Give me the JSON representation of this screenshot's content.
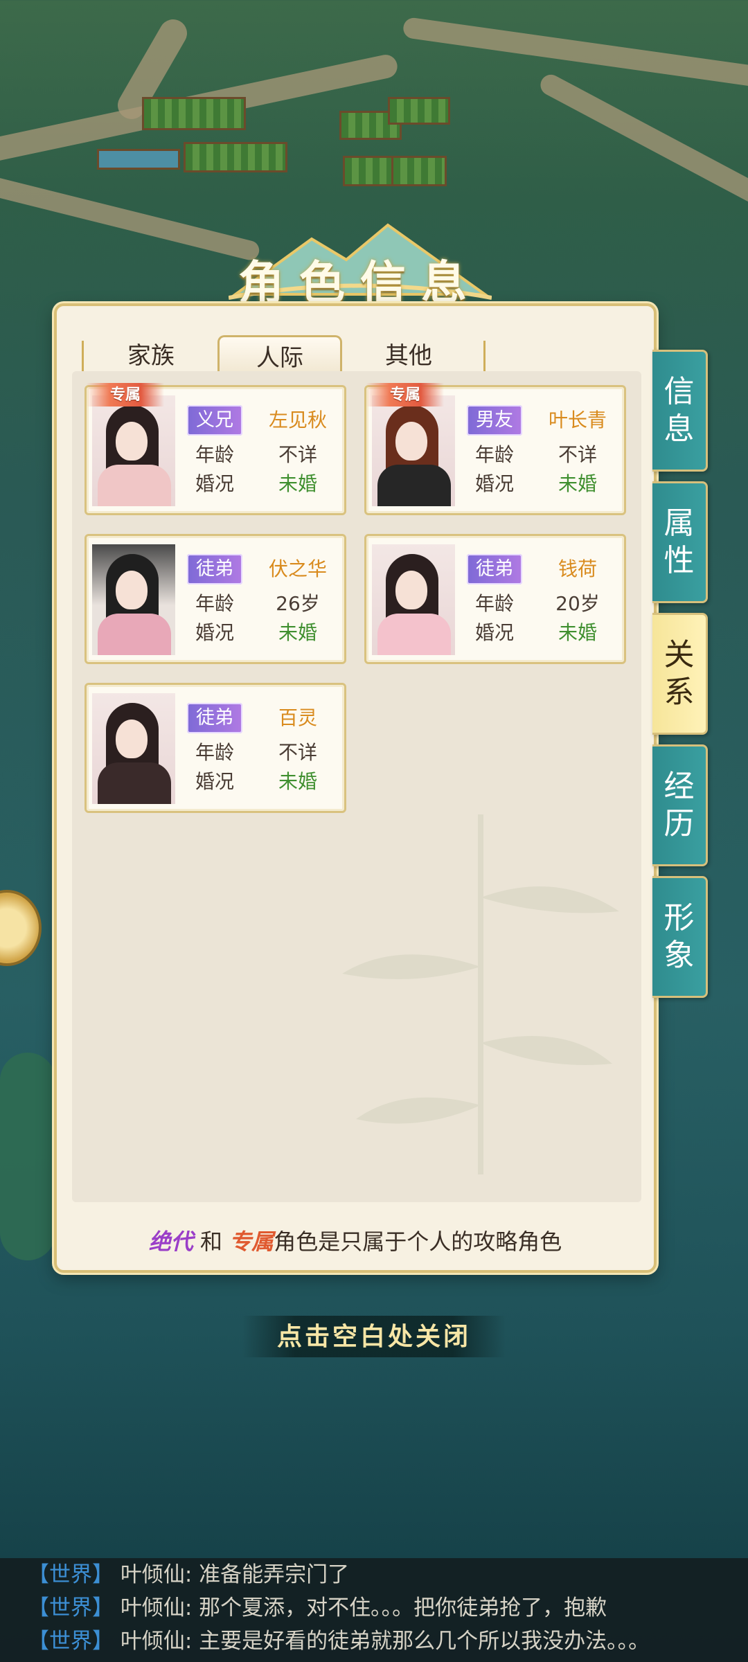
{
  "title": "角色信息",
  "tabs": [
    {
      "label": "家族",
      "active": false
    },
    {
      "label": "人际",
      "active": true
    },
    {
      "label": "其他",
      "active": false
    }
  ],
  "side_tabs": [
    {
      "label": "信息",
      "chars": [
        "信",
        "息"
      ],
      "active": false
    },
    {
      "label": "属性",
      "chars": [
        "属",
        "性"
      ],
      "active": false
    },
    {
      "label": "关系",
      "chars": [
        "关",
        "系"
      ],
      "active": true
    },
    {
      "label": "经历",
      "chars": [
        "经",
        "历"
      ],
      "active": false
    },
    {
      "label": "形象",
      "chars": [
        "形",
        "象"
      ],
      "active": false
    }
  ],
  "labels": {
    "age": "年龄",
    "marriage": "婚况"
  },
  "cards": [
    {
      "badge": "专属",
      "relation": "义兄",
      "name": "左见秋",
      "age": "不详",
      "marriage": "未婚"
    },
    {
      "badge": "专属",
      "relation": "男友",
      "name": "叶长青",
      "age": "不详",
      "marriage": "未婚"
    },
    {
      "badge": "",
      "relation": "徒弟",
      "name": "伏之华",
      "age": "26岁",
      "marriage": "未婚"
    },
    {
      "badge": "",
      "relation": "徒弟",
      "name": "钱荷",
      "age": "20岁",
      "marriage": "未婚"
    },
    {
      "badge": "",
      "relation": "徒弟",
      "name": "百灵",
      "age": "不详",
      "marriage": "未婚"
    }
  ],
  "footer_note": {
    "part1": "绝代",
    "part2": "和",
    "part3": "专属",
    "part4": "角色是只属于个人的攻略角色"
  },
  "close_hint": "点击空白处关闭",
  "chat": [
    {
      "channel": "【世界】",
      "speaker": "叶倾仙:",
      "message": "准备能弄宗门了"
    },
    {
      "channel": "【世界】",
      "speaker": "叶倾仙:",
      "message": "那个夏添，对不住。。。把你徒弟抢了，抱歉"
    },
    {
      "channel": "【世界】",
      "speaker": "叶倾仙:",
      "message": "主要是好看的徒弟就那么几个所以我没办法。。。"
    }
  ],
  "colors": {
    "accent_gold": "#d8bf77",
    "name_orange": "#d98b1e",
    "status_green": "#3f8f2f",
    "side_tab_teal": "#3a9fa0",
    "side_tab_active": "#f6e59a",
    "relation_purple": "#7e6ad6",
    "chat_channel_blue": "#3c8fd4"
  }
}
